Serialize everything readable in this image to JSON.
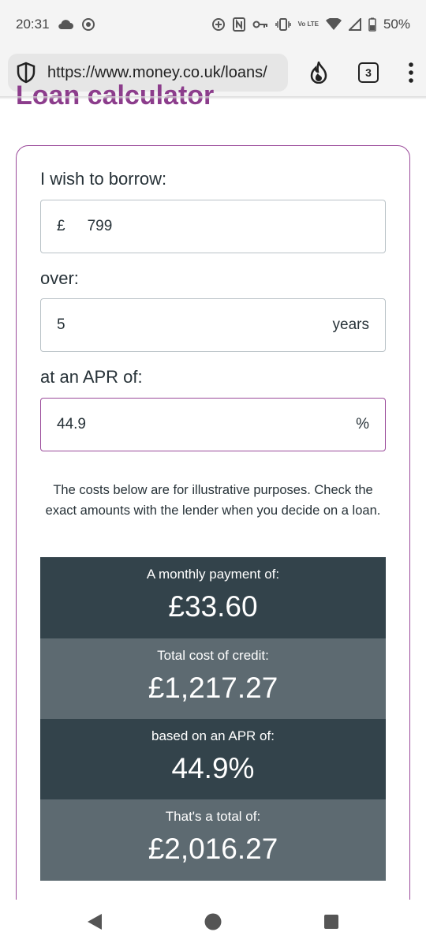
{
  "status_bar": {
    "time": "20:31",
    "network_label": "Vo LTE",
    "battery": "50%"
  },
  "browser": {
    "url": "https://www.money.co.uk/loans/",
    "tab_count": "3"
  },
  "page": {
    "heading": "Loan calculator",
    "borrow_label": "I wish to borrow:",
    "currency_symbol": "£",
    "amount": "799",
    "over_label": "over:",
    "term": "5",
    "term_unit": "years",
    "apr_label": "at an APR of:",
    "apr": "44.9",
    "apr_unit": "%",
    "disclaimer": "The costs below are for illustrative purposes. Check the exact amounts with the lender when you decide on a loan."
  },
  "results": [
    {
      "label": "A monthly payment of:",
      "value": "£33.60"
    },
    {
      "label": "Total cost of credit:",
      "value": "£1,217.27"
    },
    {
      "label": "based on an APR of:",
      "value": "44.9%"
    },
    {
      "label": "That's a total of:",
      "value": "£2,016.27"
    }
  ]
}
